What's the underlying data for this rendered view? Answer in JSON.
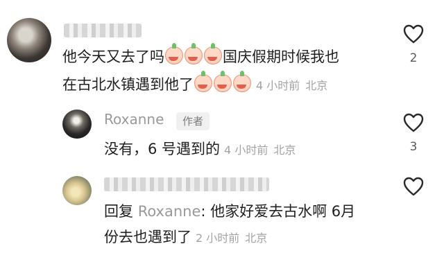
{
  "comments": [
    {
      "line1": "他今天又去了吗",
      "line1b": "国庆假期时候我也",
      "line2": "在古北水镇遇到他了",
      "time": "4 小时前",
      "location": "北京",
      "likes": "2"
    },
    {
      "username": "Roxanne",
      "badge": "作者",
      "text": "没有，6 号遇到的",
      "time": "4 小时前",
      "location": "北京",
      "likes": "3"
    },
    {
      "reply_prefix": "回复",
      "reply_to": "Roxanne",
      "line1": ": 他家好爱去古水啊 6月",
      "line2": "份去也遇到了",
      "time": "2 小时前",
      "location": "北京",
      "likes": ""
    }
  ],
  "icons": {
    "like": "heart-outline-icon",
    "emoji": "crying-face-emoji"
  }
}
